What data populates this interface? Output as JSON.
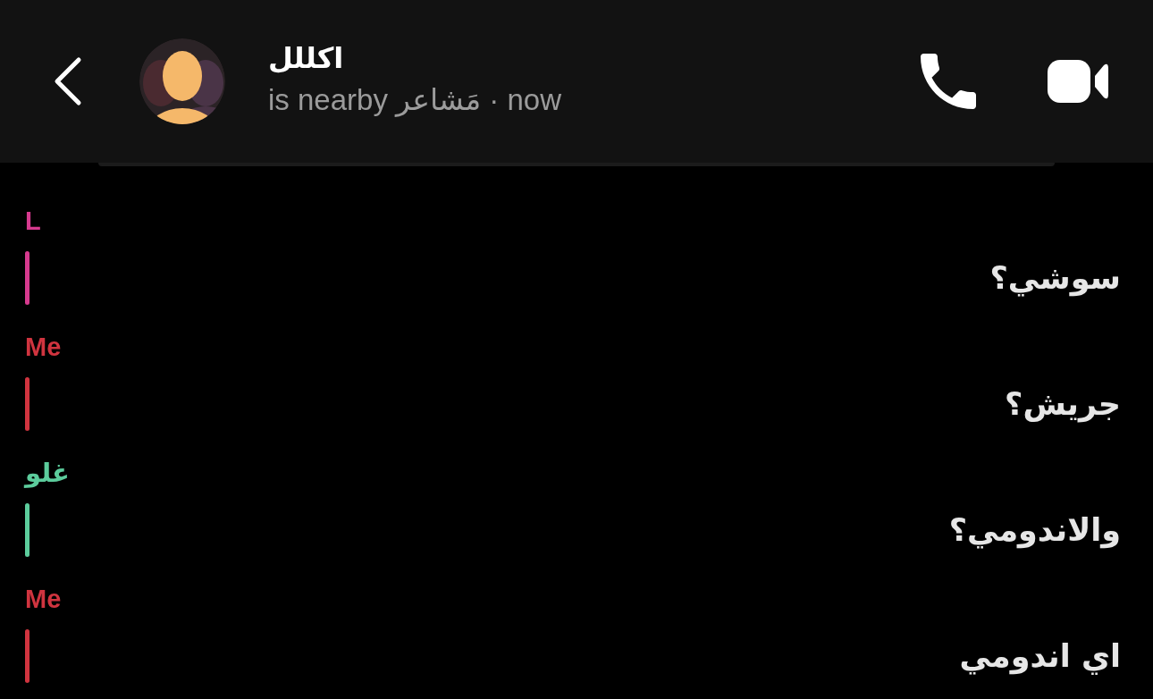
{
  "header": {
    "name": "اكللل",
    "status": "is nearby مَشاعر · now"
  },
  "messages": [
    {
      "sender": "L",
      "color": "#d63a8e",
      "text": "سوشي؟"
    },
    {
      "sender": "Me",
      "color": "#d0343f",
      "text": "جريش؟"
    },
    {
      "sender": "غلو",
      "color": "#5ccc9c",
      "text": "والاندومي؟"
    },
    {
      "sender": "Me",
      "color": "#d0343f",
      "text": "اي اندومي"
    }
  ]
}
